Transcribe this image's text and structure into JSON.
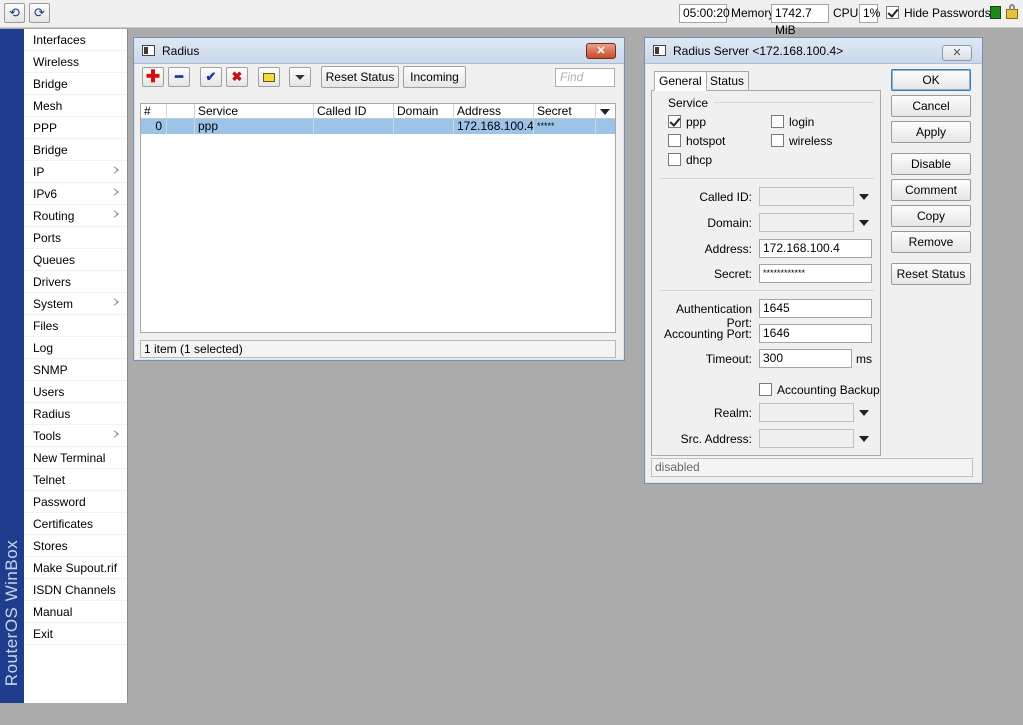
{
  "topbar": {
    "time": "05:00:20",
    "memory_label": "Memory:",
    "memory_value": "1742.7 MiB",
    "cpu_label": "CPU:",
    "cpu_value": "1%",
    "hide_passwords_label": "Hide Passwords",
    "hide_passwords_checked": true
  },
  "brand": "RouterOS WinBox",
  "sidebar": {
    "items": [
      {
        "label": "Interfaces",
        "submenu": false
      },
      {
        "label": "Wireless",
        "submenu": false
      },
      {
        "label": "Bridge",
        "submenu": false
      },
      {
        "label": "Mesh",
        "submenu": false
      },
      {
        "label": "PPP",
        "submenu": false
      },
      {
        "label": "Bridge",
        "submenu": false
      },
      {
        "label": "IP",
        "submenu": true
      },
      {
        "label": "IPv6",
        "submenu": true
      },
      {
        "label": "Routing",
        "submenu": true
      },
      {
        "label": "Ports",
        "submenu": false
      },
      {
        "label": "Queues",
        "submenu": false
      },
      {
        "label": "Drivers",
        "submenu": false
      },
      {
        "label": "System",
        "submenu": true
      },
      {
        "label": "Files",
        "submenu": false
      },
      {
        "label": "Log",
        "submenu": false
      },
      {
        "label": "SNMP",
        "submenu": false
      },
      {
        "label": "Users",
        "submenu": false
      },
      {
        "label": "Radius",
        "submenu": false
      },
      {
        "label": "Tools",
        "submenu": true
      },
      {
        "label": "New Terminal",
        "submenu": false
      },
      {
        "label": "Telnet",
        "submenu": false
      },
      {
        "label": "Password",
        "submenu": false
      },
      {
        "label": "Certificates",
        "submenu": false
      },
      {
        "label": "Stores",
        "submenu": false
      },
      {
        "label": "Make Supout.rif",
        "submenu": false
      },
      {
        "label": "ISDN Channels",
        "submenu": false
      },
      {
        "label": "Manual",
        "submenu": false
      },
      {
        "label": "Exit",
        "submenu": false
      }
    ]
  },
  "radius_window": {
    "title": "Radius",
    "reset_status_label": "Reset Status",
    "incoming_label": "Incoming",
    "find_placeholder": "Find",
    "columns": [
      "#",
      "Service",
      "Called ID",
      "Domain",
      "Address",
      "Secret"
    ],
    "rows": [
      {
        "num": "0",
        "service": "ppp",
        "called_id": "",
        "domain": "",
        "address": "172.168.100.4",
        "secret": "*****"
      }
    ],
    "status": "1 item (1 selected)"
  },
  "server_window": {
    "title": "Radius Server <172.168.100.4>",
    "tabs": [
      "General",
      "Status"
    ],
    "service_label": "Service",
    "services": [
      {
        "label": "ppp",
        "checked": true
      },
      {
        "label": "login",
        "checked": false
      },
      {
        "label": "hotspot",
        "checked": false
      },
      {
        "label": "wireless",
        "checked": false
      },
      {
        "label": "dhcp",
        "checked": false
      }
    ],
    "called_id_label": "Called ID:",
    "domain_label": "Domain:",
    "address_label": "Address:",
    "address_value": "172.168.100.4",
    "secret_label": "Secret:",
    "secret_value": "************",
    "auth_port_label": "Authentication Port:",
    "auth_port_value": "1645",
    "acct_port_label": "Accounting Port:",
    "acct_port_value": "1646",
    "timeout_label": "Timeout:",
    "timeout_value": "300",
    "timeout_unit": "ms",
    "accounting_backup_label": "Accounting Backup",
    "realm_label": "Realm:",
    "src_address_label": "Src. Address:",
    "buttons": [
      "OK",
      "Cancel",
      "Apply",
      "Disable",
      "Comment",
      "Copy",
      "Remove",
      "Reset Status"
    ],
    "status": "disabled"
  }
}
